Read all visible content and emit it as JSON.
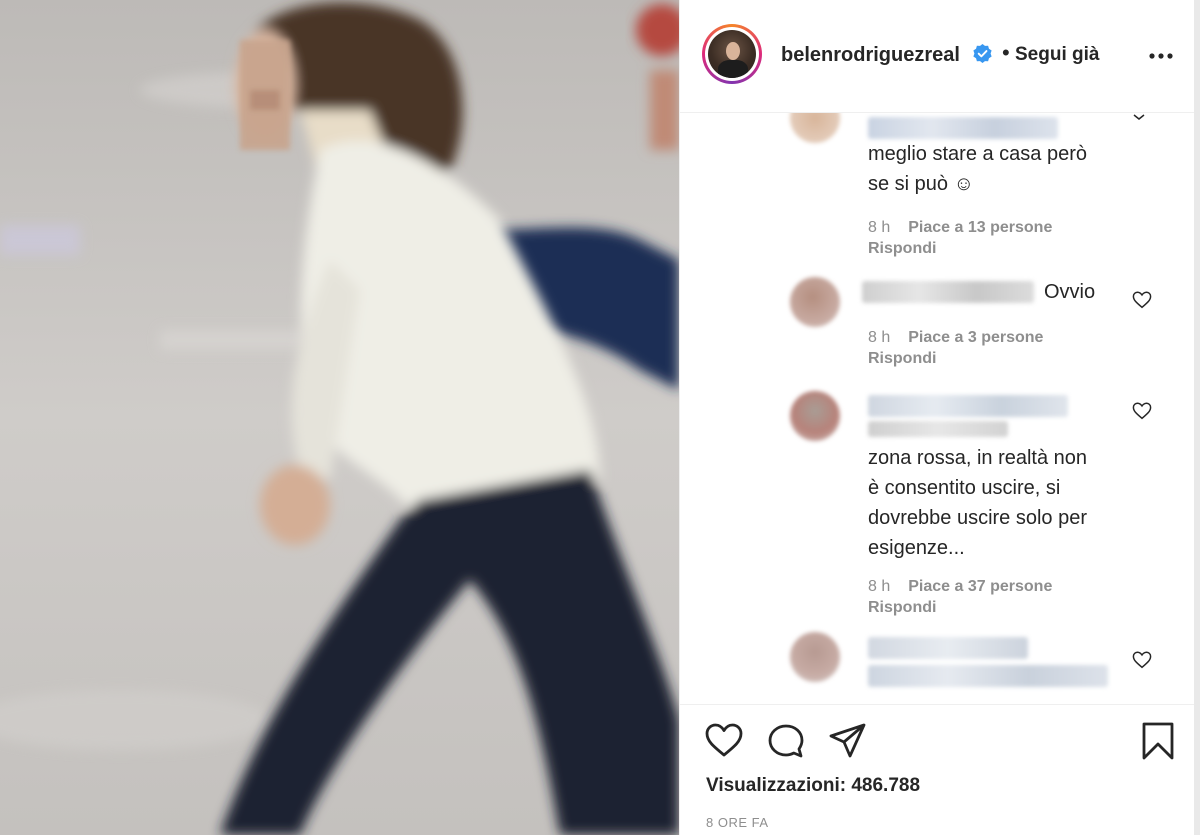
{
  "header": {
    "username": "belenrodriguezreal",
    "follow_label": "Segui già",
    "separator": "•"
  },
  "comments": [
    {
      "text": "meglio stare a casa però\nse si può ☺",
      "time": "8 h",
      "likes": "Piace a 13 persone",
      "reply": "Rispondi"
    },
    {
      "text": "Ovvio",
      "time": "8 h",
      "likes": "Piace a 3 persone",
      "reply": "Rispondi"
    },
    {
      "text": "zona rossa, in realtà non\nè consentito uscire, si\ndovrebbe uscire solo per\nesigenze...",
      "time": "8 h",
      "likes": "Piace a 37 persone",
      "reply": "Rispondi"
    }
  ],
  "footer": {
    "views_label": "Visualizzazioni: 486.788",
    "time_ago": "8 ORE FA"
  },
  "icons": [
    "verified-badge-icon",
    "more-options-icon",
    "heart-icon",
    "comment-icon",
    "share-icon",
    "bookmark-icon"
  ],
  "colors": {
    "verified": "#3897f0",
    "text": "#262626",
    "muted": "#8e8e8e"
  }
}
